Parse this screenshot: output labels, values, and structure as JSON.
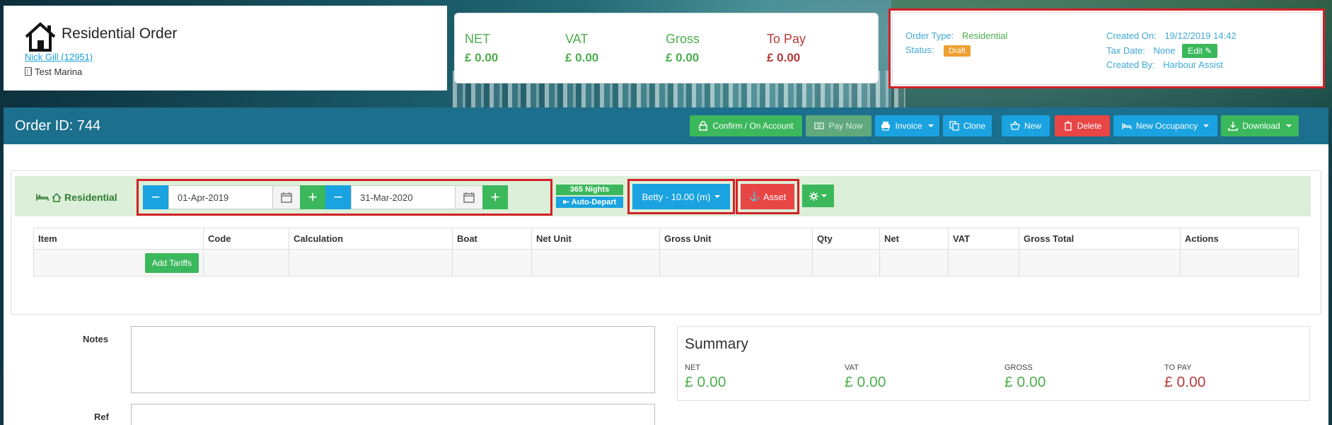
{
  "header": {
    "title": "Residential Order",
    "customer_link": "Nick Gill (12951)",
    "location": "Test Marina"
  },
  "totals": {
    "net_label": "NET",
    "net_value": "£ 0.00",
    "vat_label": "VAT",
    "vat_value": "£ 0.00",
    "gross_label": "Gross",
    "gross_value": "£ 0.00",
    "topay_label": "To Pay",
    "topay_value": "£ 0.00"
  },
  "info": {
    "order_type_key": "Order Type:",
    "order_type_val": "Residential",
    "status_key": "Status:",
    "status_val": "Draft",
    "created_on_key": "Created On:",
    "created_on_val": "19/12/2019 14:42",
    "tax_date_key": "Tax Date:",
    "tax_date_val": "None",
    "edit_label": "Edit",
    "created_by_key": "Created By:",
    "created_by_val": "Harbour Assist"
  },
  "toolbar": {
    "order_id": "Order ID: 744",
    "confirm": "Confirm / On Account",
    "pay_now": "Pay Now",
    "invoice": "Invoice",
    "clone": "Clone",
    "new": "New",
    "delete": "Delete",
    "new_occupancy": "New Occupancy",
    "download": "Download"
  },
  "residential": {
    "label": "Residential",
    "start_date": "01-Apr-2019",
    "end_date": "31-Mar-2020",
    "nights": "365 Nights",
    "auto_depart": "Auto-Depart",
    "boat": "Betty - 10.00 (m)",
    "asset": "Asset"
  },
  "table": {
    "headers": [
      "Item",
      "Code",
      "Calculation",
      "Boat",
      "Net Unit",
      "Gross Unit",
      "Qty",
      "Net",
      "VAT",
      "Gross Total",
      "Actions"
    ],
    "add_tariffs": "Add Tariffs"
  },
  "form": {
    "notes_label": "Notes",
    "ref_label": "Ref"
  },
  "summary": {
    "title": "Summary",
    "net_label": "NET",
    "net_value": "£ 0.00",
    "vat_label": "VAT",
    "vat_value": "£ 0.00",
    "gross_label": "GROSS",
    "gross_value": "£ 0.00",
    "topay_label": "TO PAY",
    "topay_value": "£ 0.00"
  },
  "colors": {
    "primary_bar": "#1c6f8d",
    "green": "#3cb85c",
    "blue": "#1aa3e0",
    "red": "#e84545",
    "highlight_border": "#d42027"
  }
}
